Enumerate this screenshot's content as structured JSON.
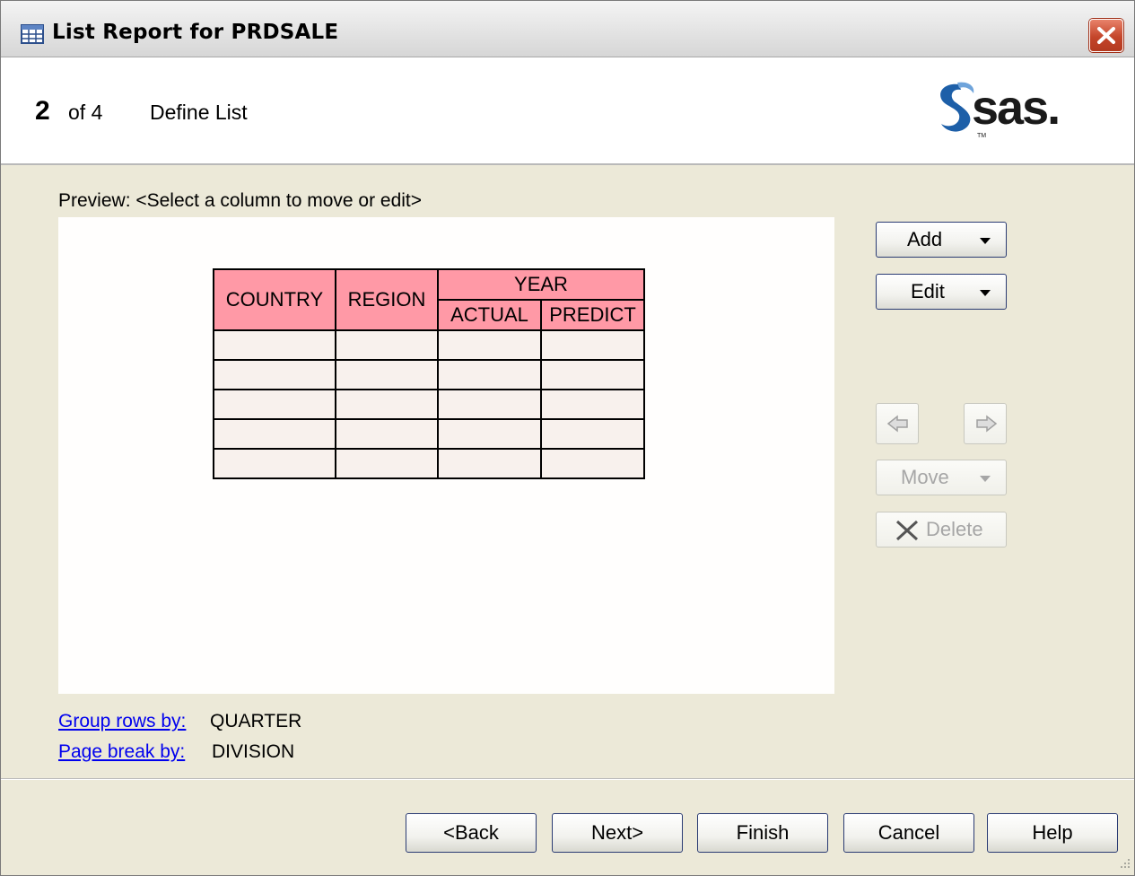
{
  "window": {
    "title": "List Report for PRDSALE"
  },
  "header": {
    "step_number": "2",
    "step_of": "of 4",
    "step_title": "Define List",
    "logo_text": "sas."
  },
  "preview": {
    "label": "Preview: <Select a column to move or edit>",
    "columns": [
      "COUNTRY",
      "REGION"
    ],
    "group_header": "YEAR",
    "sub_columns": [
      "ACTUAL",
      "PREDICT"
    ],
    "empty_rows": 5
  },
  "side_buttons": {
    "add": "Add",
    "edit": "Edit",
    "move": "Move",
    "delete": "Delete"
  },
  "options": {
    "group_link": "Group rows by:",
    "group_value": "QUARTER",
    "page_link": "Page break by:",
    "page_value": "DIVISION"
  },
  "footer": {
    "back": "<Back",
    "next": "Next>",
    "finish": "Finish",
    "cancel": "Cancel",
    "help": "Help"
  },
  "colors": {
    "header_cell": "#ff99a6",
    "body_cell": "#f8f1ed",
    "dialog_bg": "#ece9d8",
    "link": "#0000ee"
  }
}
